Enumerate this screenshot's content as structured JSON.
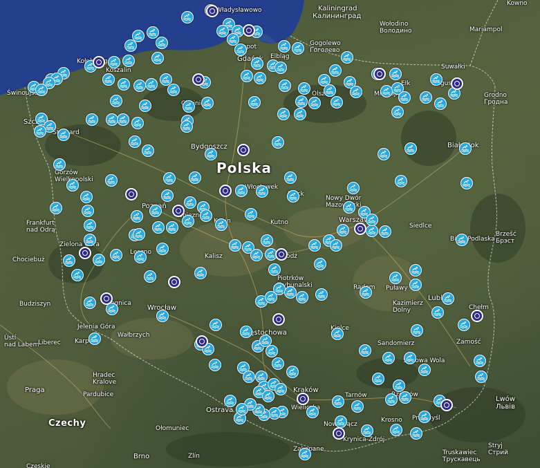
{
  "map": {
    "sea_color": "#243f8e",
    "marker_color": "#29a8e0",
    "poi_color": "#2d2a8c",
    "marker_icon": "swimming-icon",
    "poi_icon": "target-circle-icon",
    "labels": [
      {
        "id": "polska",
        "text": "Polska",
        "cls": "capital"
      },
      {
        "id": "czechy",
        "text": "Czechy",
        "cls": "country"
      },
      {
        "id": "gdansk",
        "text": "Gdańsk",
        "cls": ""
      },
      {
        "id": "bydgoszcz",
        "text": "Bydgoszcz",
        "cls": ""
      },
      {
        "id": "poznan",
        "text": "Poznań",
        "cls": ""
      },
      {
        "id": "wroclaw",
        "text": "Wrocław",
        "cls": ""
      },
      {
        "id": "krakow",
        "text": "Kraków",
        "cls": ""
      },
      {
        "id": "warszawa",
        "text": "Warszawa",
        "cls": ""
      },
      {
        "id": "lublin",
        "text": "Lublin",
        "cls": ""
      },
      {
        "id": "czestochowa",
        "text": "Częstochowa",
        "cls": ""
      },
      {
        "id": "szczecin",
        "text": "Szczecin",
        "cls": ""
      },
      {
        "id": "bialystok",
        "text": "Białystok",
        "cls": ""
      },
      {
        "id": "kaliningrad",
        "text": "Kaliningrad",
        "cls": ""
      },
      {
        "id": "kaliningrad_ru",
        "text": "Калининград",
        "cls": ""
      },
      {
        "id": "kolobrzeg",
        "text": "Kołobrzeg",
        "cls": "small"
      },
      {
        "id": "koszalin",
        "text": "Koszalin",
        "cls": "small"
      },
      {
        "id": "swinoujscie",
        "text": "Świnoujście",
        "cls": "small"
      },
      {
        "id": "stargard",
        "text": "Stargard",
        "cls": "small"
      },
      {
        "id": "gorzow",
        "text": "Gorzów\nWielkopolski",
        "cls": "small"
      },
      {
        "id": "frankfurt",
        "text": "Frankfurt\nnad Odrą",
        "cls": "small"
      },
      {
        "id": "zielona",
        "text": "Zielona Góra",
        "cls": "small"
      },
      {
        "id": "chociebuz",
        "text": "Chociebuż",
        "cls": "small"
      },
      {
        "id": "leszno",
        "text": "Leszno",
        "cls": "small"
      },
      {
        "id": "budziszyn",
        "text": "Budziszyn",
        "cls": "small"
      },
      {
        "id": "legnica",
        "text": "Legnica",
        "cls": "small"
      },
      {
        "id": "jelenia",
        "text": "Jelenia Góra",
        "cls": "small"
      },
      {
        "id": "walbrzych",
        "text": "Wałbrzych",
        "cls": "small"
      },
      {
        "id": "karpacz",
        "text": "Karpacz",
        "cls": "small"
      },
      {
        "id": "usti",
        "text": "Ústí\nnad Labem",
        "cls": "small"
      },
      {
        "id": "liberec",
        "text": "Liberec",
        "cls": "small"
      },
      {
        "id": "hradec",
        "text": "Hradec\nKralove",
        "cls": "small"
      },
      {
        "id": "pardubice",
        "text": "Pardubice",
        "cls": "small"
      },
      {
        "id": "praga",
        "text": "Praga",
        "cls": ""
      },
      {
        "id": "ostrava",
        "text": "Ostrava",
        "cls": ""
      },
      {
        "id": "olomuniec",
        "text": "Ołomuniec",
        "cls": "small"
      },
      {
        "id": "brno",
        "text": "Brno",
        "cls": ""
      },
      {
        "id": "zlin",
        "text": "Zlín",
        "cls": "small"
      },
      {
        "id": "czeskie",
        "text": "Czeskie",
        "cls": "small"
      },
      {
        "id": "kalisz",
        "text": "Kalisz",
        "cls": "small"
      },
      {
        "id": "konin",
        "text": "Konin",
        "cls": "small"
      },
      {
        "id": "kutno",
        "text": "Kutno",
        "cls": "small"
      },
      {
        "id": "lodz",
        "text": "Łódź",
        "cls": "small"
      },
      {
        "id": "piotrkow",
        "text": "Piotrków\nTrybunalski",
        "cls": "small"
      },
      {
        "id": "radom",
        "text": "Radom",
        "cls": "small"
      },
      {
        "id": "kielce",
        "text": "Kielce",
        "cls": "small"
      },
      {
        "id": "sandomierz",
        "text": "Sandomierz",
        "cls": "small"
      },
      {
        "id": "stalowa",
        "text": "Stalowa Wola",
        "cls": "small"
      },
      {
        "id": "pulawy",
        "text": "Puławy",
        "cls": "small"
      },
      {
        "id": "kazimierz",
        "text": "Kazimierz\nDolny",
        "cls": "small"
      },
      {
        "id": "tarnow",
        "text": "Tarnów",
        "cls": "small"
      },
      {
        "id": "rzeszow",
        "text": "Rzeszów",
        "cls": "small"
      },
      {
        "id": "krosno",
        "text": "Krosno",
        "cls": "small"
      },
      {
        "id": "przemysl",
        "text": "Przemyśl",
        "cls": "small"
      },
      {
        "id": "nowysacz",
        "text": "Nowy Sącz",
        "cls": "small"
      },
      {
        "id": "krynica",
        "text": "Krynica-Zdrój",
        "cls": "small"
      },
      {
        "id": "wieliczka",
        "text": "Wieliczka",
        "cls": "small"
      },
      {
        "id": "zakopane",
        "text": "Zakopane",
        "cls": "small"
      },
      {
        "id": "chelm",
        "text": "Chełm",
        "cls": "small"
      },
      {
        "id": "zamosc",
        "text": "Zamość",
        "cls": "small"
      },
      {
        "id": "lwow",
        "text": "Lwów\nЛьвів",
        "cls": ""
      },
      {
        "id": "truskawiec",
        "text": "Truskawiec\nТрускавець",
        "cls": "small"
      },
      {
        "id": "stryj",
        "text": "Stryj\nСтрий",
        "cls": "small"
      },
      {
        "id": "biala",
        "text": "Biała Podlaska",
        "cls": "small"
      },
      {
        "id": "brzesc",
        "text": "Brzešć\nБрэст",
        "cls": "small"
      },
      {
        "id": "siedlce",
        "text": "Siedlce",
        "cls": "small"
      },
      {
        "id": "nowydwor",
        "text": "Nowy Dwór\nMazowiecki",
        "cls": "small"
      },
      {
        "id": "plock",
        "text": "Płock",
        "cls": "small"
      },
      {
        "id": "wloclawek",
        "text": "Włocławek",
        "cls": "small"
      },
      {
        "id": "gniezno",
        "text": "Gniezno",
        "cls": "small"
      },
      {
        "id": "elblag",
        "text": "Elbląg",
        "cls": "small"
      },
      {
        "id": "olsztyn",
        "text": "Olsztyn",
        "cls": "small"
      },
      {
        "id": "elk",
        "text": "Ełk",
        "cls": "small"
      },
      {
        "id": "suwalki",
        "text": "Suwałki",
        "cls": "small"
      },
      {
        "id": "augustow",
        "text": "Augustów",
        "cls": "small"
      },
      {
        "id": "grodno",
        "text": "Grodno\nГродна",
        "cls": "small"
      },
      {
        "id": "mikolajki",
        "text": "Mikołajki",
        "cls": "small"
      },
      {
        "id": "gogolewo",
        "text": "Gogolewo\nГоголево",
        "cls": "small"
      },
      {
        "id": "wolodino",
        "text": "Wołodino\nВолодино",
        "cls": "small"
      },
      {
        "id": "mariampol",
        "text": "Mariampol",
        "cls": "small"
      },
      {
        "id": "kowno",
        "text": "Kowno",
        "cls": "small"
      },
      {
        "id": "sopot",
        "text": "Sopot",
        "cls": "small"
      },
      {
        "id": "wladyslawowo",
        "text": "Władysławowo",
        "cls": "small"
      },
      {
        "id": "chojnice",
        "text": "Chojnice",
        "cls": "small"
      }
    ]
  }
}
